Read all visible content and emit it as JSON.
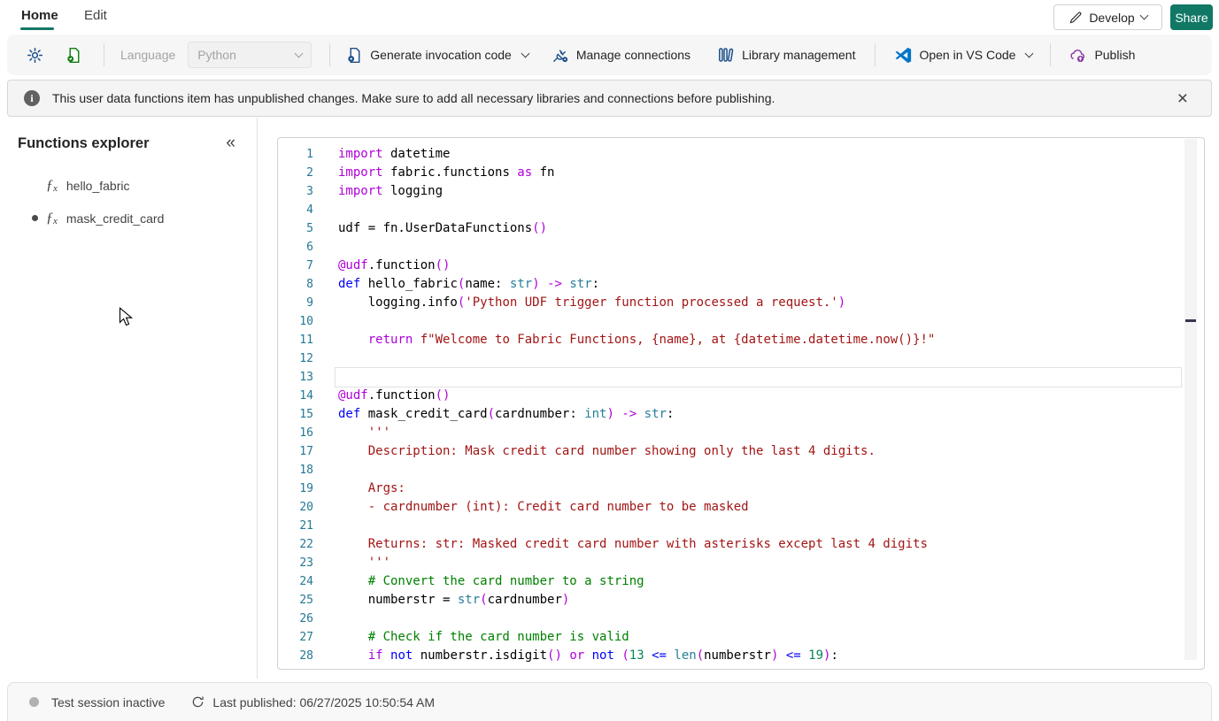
{
  "tabs": {
    "home": "Home",
    "edit": "Edit"
  },
  "header_actions": {
    "develop": "Develop",
    "share": "Share"
  },
  "toolbar": {
    "language_label": "Language",
    "language_value": "Python",
    "generate": "Generate invocation code",
    "manage": "Manage connections",
    "library": "Library management",
    "vscode": "Open in VS Code",
    "publish": "Publish"
  },
  "banner": {
    "text": "This user data functions item has unpublished changes. Make sure to add all necessary libraries and connections before publishing.",
    "close": "×"
  },
  "sidebar": {
    "title": "Functions explorer",
    "collapse_glyph": "«",
    "items": [
      {
        "label": "hello_fabric",
        "modified": false
      },
      {
        "label": "mask_credit_card",
        "modified": true
      }
    ]
  },
  "editor": {
    "current_line": 13,
    "lines": [
      [
        [
          "p",
          "import"
        ],
        [
          "x",
          " datetime"
        ]
      ],
      [
        [
          "p",
          "import"
        ],
        [
          "x",
          " fabric.functions "
        ],
        [
          "p",
          "as"
        ],
        [
          "x",
          " fn"
        ]
      ],
      [
        [
          "p",
          "import"
        ],
        [
          "x",
          " logging"
        ]
      ],
      [],
      [
        [
          "x",
          "udf = fn.UserDataFunctions"
        ],
        [
          "p",
          "()"
        ]
      ],
      [],
      [
        [
          "p",
          "@udf"
        ],
        [
          "x",
          ".function"
        ],
        [
          "p",
          "()"
        ]
      ],
      [
        [
          "b",
          "def"
        ],
        [
          "x",
          " hello_fabric"
        ],
        [
          "p",
          "("
        ],
        [
          "x",
          "name: "
        ],
        [
          "t",
          "str"
        ],
        [
          "p",
          ")"
        ],
        [
          "x",
          " "
        ],
        [
          "p",
          "->"
        ],
        [
          "x",
          " "
        ],
        [
          "t",
          "str"
        ],
        [
          "x",
          ":"
        ]
      ],
      [
        [
          "x",
          "    logging.info"
        ],
        [
          "p",
          "("
        ],
        [
          "s",
          "'Python UDF trigger function processed a request.'"
        ],
        [
          "p",
          ")"
        ]
      ],
      [],
      [
        [
          "x",
          "    "
        ],
        [
          "p",
          "return"
        ],
        [
          "x",
          " "
        ],
        [
          "s",
          "f\"Welcome to Fabric Functions, {name}, at {datetime.datetime.now()}!\""
        ]
      ],
      [],
      [],
      [
        [
          "p",
          "@udf"
        ],
        [
          "x",
          ".function"
        ],
        [
          "p",
          "()"
        ]
      ],
      [
        [
          "b",
          "def"
        ],
        [
          "x",
          " mask_credit_card"
        ],
        [
          "p",
          "("
        ],
        [
          "x",
          "cardnumber: "
        ],
        [
          "t",
          "int"
        ],
        [
          "p",
          ")"
        ],
        [
          "x",
          " "
        ],
        [
          "p",
          "->"
        ],
        [
          "x",
          " "
        ],
        [
          "t",
          "str"
        ],
        [
          "x",
          ":"
        ]
      ],
      [
        [
          "x",
          "    "
        ],
        [
          "s",
          "'''"
        ]
      ],
      [
        [
          "x",
          "    "
        ],
        [
          "s",
          "Description: Mask credit card number showing only the last 4 digits."
        ]
      ],
      [],
      [
        [
          "x",
          "    "
        ],
        [
          "s",
          "Args:"
        ]
      ],
      [
        [
          "x",
          "    "
        ],
        [
          "s",
          "- cardnumber (int): Credit card number to be masked"
        ]
      ],
      [],
      [
        [
          "x",
          "    "
        ],
        [
          "s",
          "Returns: str: Masked credit card number with asterisks except last 4 digits"
        ]
      ],
      [
        [
          "x",
          "    "
        ],
        [
          "s",
          "'''"
        ]
      ],
      [
        [
          "x",
          "    "
        ],
        [
          "c",
          "# Convert the card number to a string"
        ]
      ],
      [
        [
          "x",
          "    numberstr = "
        ],
        [
          "t",
          "str"
        ],
        [
          "p",
          "("
        ],
        [
          "x",
          "cardnumber"
        ],
        [
          "p",
          ")"
        ]
      ],
      [],
      [
        [
          "x",
          "    "
        ],
        [
          "c",
          "# Check if the card number is valid"
        ]
      ],
      [
        [
          "x",
          "    "
        ],
        [
          "p",
          "if"
        ],
        [
          "x",
          " "
        ],
        [
          "b",
          "not"
        ],
        [
          "x",
          " numberstr.isdigit"
        ],
        [
          "p",
          "()"
        ],
        [
          "x",
          " "
        ],
        [
          "p",
          "or"
        ],
        [
          "x",
          " "
        ],
        [
          "b",
          "not"
        ],
        [
          "x",
          " "
        ],
        [
          "p",
          "("
        ],
        [
          "n",
          "13"
        ],
        [
          "x",
          " "
        ],
        [
          "b",
          "<="
        ],
        [
          "x",
          " "
        ],
        [
          "t",
          "len"
        ],
        [
          "p",
          "("
        ],
        [
          "x",
          "numberstr"
        ],
        [
          "p",
          ")"
        ],
        [
          "x",
          " "
        ],
        [
          "b",
          "<="
        ],
        [
          "x",
          " "
        ],
        [
          "n",
          "19"
        ],
        [
          "p",
          ")"
        ],
        [
          "x",
          ":"
        ]
      ]
    ]
  },
  "statusbar": {
    "session": "Test session inactive",
    "published": "Last published: 06/27/2025 10:50:54 AM"
  },
  "colors": {
    "accent_teal": "#117865",
    "toolbar_icon_blue": "#1b4e89",
    "file_icon_green": "#107c10",
    "publish_purple": "#8a3ba8",
    "vscode_blue": "#0075c9",
    "keyword_purple": "#af00db",
    "keyword_blue": "#0000ff",
    "type_teal": "#267f99",
    "string_red": "#a31515",
    "comment_green": "#008000",
    "number_green": "#098658",
    "line_number": "#237893"
  }
}
